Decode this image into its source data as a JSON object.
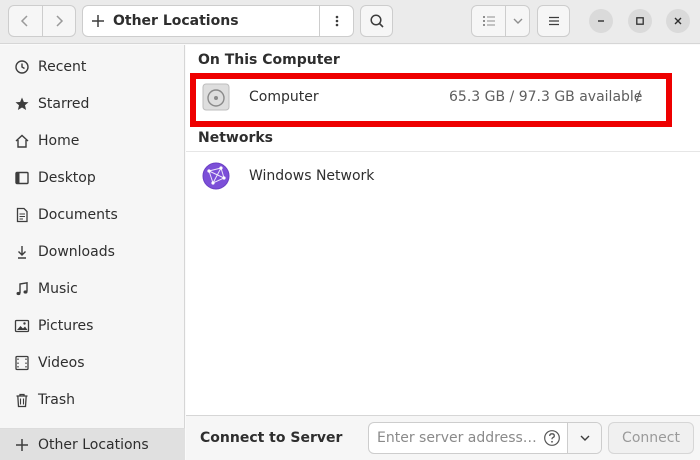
{
  "window": {
    "location_title": "Other Locations"
  },
  "sidebar": {
    "items": [
      {
        "label": "Recent",
        "icon": "clock-icon"
      },
      {
        "label": "Starred",
        "icon": "star-icon"
      },
      {
        "label": "Home",
        "icon": "home-icon"
      },
      {
        "label": "Desktop",
        "icon": "desktop-icon"
      },
      {
        "label": "Documents",
        "icon": "document-icon"
      },
      {
        "label": "Downloads",
        "icon": "download-icon"
      },
      {
        "label": "Music",
        "icon": "music-icon"
      },
      {
        "label": "Pictures",
        "icon": "picture-icon"
      },
      {
        "label": "Videos",
        "icon": "video-icon"
      },
      {
        "label": "Trash",
        "icon": "trash-icon"
      }
    ],
    "other_locations_label": "Other Locations"
  },
  "main": {
    "on_this_computer_title": "On This Computer",
    "computer": {
      "name": "Computer",
      "available": "65.3 GB / 97.3 GB available",
      "mount": "/"
    },
    "networks_title": "Networks",
    "windows_network": {
      "name": "Windows Network"
    }
  },
  "connect": {
    "label": "Connect to Server",
    "placeholder": "Enter server address…",
    "button_label": "Connect"
  },
  "colors": {
    "highlight": "#ee0000",
    "network_icon": "#7c4fd8"
  }
}
